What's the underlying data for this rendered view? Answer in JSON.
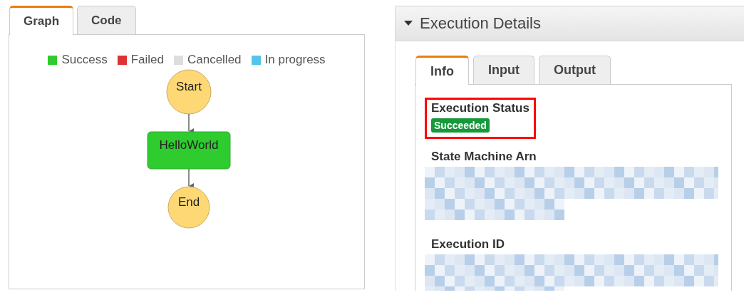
{
  "graph_panel": {
    "tabs": [
      {
        "label": "Graph",
        "selected": true
      },
      {
        "label": "Code",
        "selected": false
      }
    ],
    "legend": [
      {
        "label": "Success",
        "color": "#2ecc2e"
      },
      {
        "label": "Failed",
        "color": "#dd3333"
      },
      {
        "label": "Cancelled",
        "color": "#dddddd"
      },
      {
        "label": "In progress",
        "color": "#55c4ea"
      }
    ],
    "nodes": [
      {
        "kind": "terminal",
        "label": "Start",
        "color": "#fdd874"
      },
      {
        "kind": "task",
        "label": "HelloWorld",
        "color": "#2ecc2e"
      },
      {
        "kind": "terminal",
        "label": "End",
        "color": "#fdd874"
      }
    ]
  },
  "details_panel": {
    "title": "Execution Details",
    "expanded": true,
    "tabs": [
      {
        "label": "Info",
        "selected": true
      },
      {
        "label": "Input",
        "selected": false
      },
      {
        "label": "Output",
        "selected": false
      }
    ],
    "fields": [
      {
        "label": "Execution Status",
        "kind": "badge",
        "value": "Succeeded",
        "highlighted": true
      },
      {
        "label": "State Machine Arn",
        "kind": "redacted",
        "highlighted": false
      },
      {
        "label": "Execution ID",
        "kind": "redacted",
        "highlighted": false
      }
    ]
  }
}
